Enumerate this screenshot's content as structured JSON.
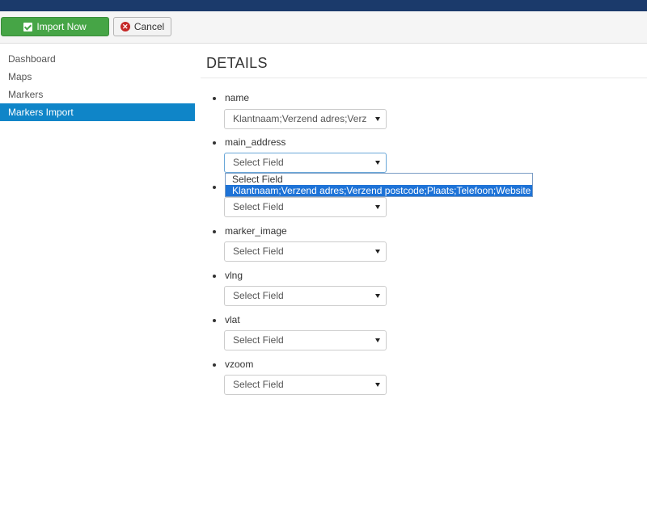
{
  "toolbar": {
    "import_label": "Import Now",
    "cancel_label": "Cancel"
  },
  "sidebar": {
    "items": [
      {
        "label": "Dashboard",
        "active": false
      },
      {
        "label": "Maps",
        "active": false
      },
      {
        "label": "Markers",
        "active": false
      },
      {
        "label": "Markers Import",
        "active": true
      }
    ]
  },
  "main": {
    "title": "DETAILS",
    "fields": [
      {
        "label": "name",
        "value": "Klantnaam;Verzend adres;Verz"
      },
      {
        "label": "main_address",
        "value": "Select Field"
      },
      {
        "label": "",
        "value": "Select Field"
      },
      {
        "label": "marker_image",
        "value": "Select Field"
      },
      {
        "label": "vlng",
        "value": "Select Field"
      },
      {
        "label": "vlat",
        "value": "Select Field"
      },
      {
        "label": "vzoom",
        "value": "Select Field"
      }
    ],
    "dropdown_options": [
      "Select Field",
      "Klantnaam;Verzend adres;Verzend postcode;Plaats;Telefoon;Website"
    ]
  },
  "colors": {
    "accent": "#0f85c8",
    "import_green": "#46a546",
    "topbar": "#1b3a6b"
  }
}
